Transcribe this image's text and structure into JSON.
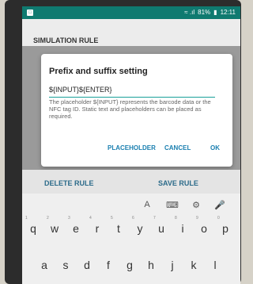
{
  "status_bar": {
    "signal_text": "≈ .ıl",
    "battery": "81%",
    "time": "12:11"
  },
  "app_bar": {
    "title": "SIMULATION RULE"
  },
  "dialog": {
    "title": "Prefix and suffix setting",
    "input_value": "${INPUT}${ENTER}",
    "help_text": "The placeholder ${INPUT} represents the barcode data or the NFC tag ID. Static text and placeholders can be placed as required.",
    "buttons": {
      "placeholder": "PLACEHOLDER",
      "cancel": "CANCEL",
      "ok": "OK"
    }
  },
  "actions": {
    "delete": "DELETE RULE",
    "save": "SAVE RULE"
  },
  "keyboard": {
    "toolbar": {
      "text": "A",
      "keyboard": "⌨",
      "settings": "⚙",
      "mic": "🎤"
    },
    "row1": [
      {
        "k": "q",
        "h": "1"
      },
      {
        "k": "w",
        "h": "2"
      },
      {
        "k": "e",
        "h": "3"
      },
      {
        "k": "r",
        "h": "4"
      },
      {
        "k": "t",
        "h": "5"
      },
      {
        "k": "y",
        "h": "6"
      },
      {
        "k": "u",
        "h": "7"
      },
      {
        "k": "i",
        "h": "8"
      },
      {
        "k": "o",
        "h": "9"
      },
      {
        "k": "p",
        "h": "0"
      }
    ],
    "row2": [
      {
        "k": "a",
        "h": ""
      },
      {
        "k": "s",
        "h": ""
      },
      {
        "k": "d",
        "h": ""
      },
      {
        "k": "f",
        "h": ""
      },
      {
        "k": "g",
        "h": ""
      },
      {
        "k": "h",
        "h": ""
      },
      {
        "k": "j",
        "h": ""
      },
      {
        "k": "k",
        "h": ""
      },
      {
        "k": "l",
        "h": ""
      }
    ]
  },
  "colors": {
    "accent": "#1aa099",
    "statusbar": "#0f7a70",
    "button_text": "#1a7fb0"
  }
}
